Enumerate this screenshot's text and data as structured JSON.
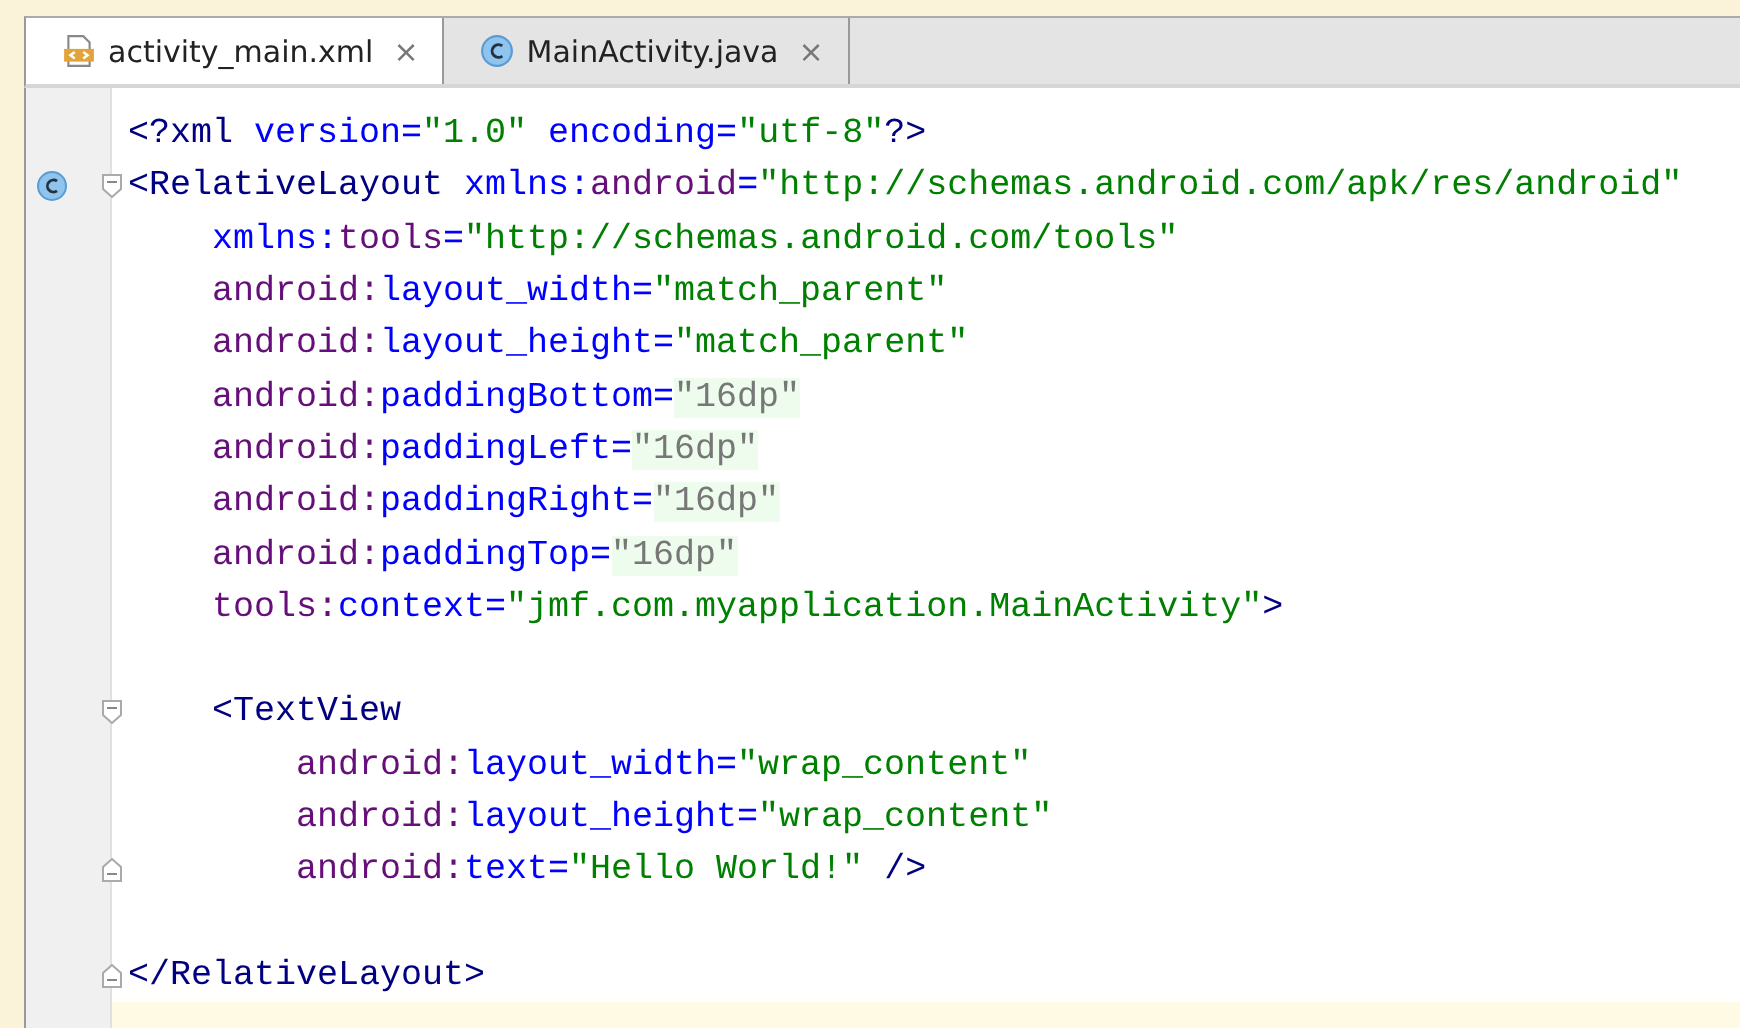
{
  "tabs": [
    {
      "label": "activity_main.xml",
      "kind": "xml",
      "selected": true,
      "close": "×"
    },
    {
      "label": "MainActivity.java",
      "kind": "class",
      "selected": false,
      "close": "×"
    }
  ],
  "lines": [
    {
      "kind": "plain",
      "tokens": [
        {
          "t": "<?xml",
          "kind": "tag"
        },
        {
          "t": " version=",
          "kind": "attr"
        },
        {
          "t": "\"1.0\"",
          "kind": "value"
        },
        {
          "t": " encoding=",
          "kind": "attr"
        },
        {
          "t": "\"utf-8\"",
          "kind": "value"
        },
        {
          "t": "?>",
          "kind": "tag"
        }
      ]
    },
    {
      "kind": "class-open",
      "tokens": [
        {
          "t": "<RelativeLayout",
          "kind": "tag"
        },
        {
          "t": " xmlns:",
          "kind": "attr"
        },
        {
          "t": "android",
          "kind": "ns"
        },
        {
          "t": "=",
          "kind": "attr"
        },
        {
          "t": "\"http://schemas.android.com/apk/res/android\"",
          "kind": "value"
        }
      ],
      "children": [
        {
          "kind": "plain",
          "tokens": [
            {
              "t": "xmlns:",
              "kind": "attr"
            },
            {
              "t": "tools",
              "kind": "ns"
            },
            {
              "t": "=",
              "kind": "attr"
            },
            {
              "t": "\"http://schemas.android.com/tools\"",
              "kind": "value"
            }
          ]
        },
        {
          "kind": "plain",
          "tokens": [
            {
              "t": "android:",
              "kind": "ns"
            },
            {
              "t": "layout_width=",
              "kind": "attr"
            },
            {
              "t": "\"match_parent\"",
              "kind": "value"
            }
          ]
        },
        {
          "kind": "plain",
          "tokens": [
            {
              "t": "android:",
              "kind": "ns"
            },
            {
              "t": "layout_height=",
              "kind": "attr"
            },
            {
              "t": "\"match_parent\"",
              "kind": "value"
            }
          ]
        },
        {
          "kind": "plain",
          "tokens": [
            {
              "t": "android:",
              "kind": "ns"
            },
            {
              "t": "paddingBottom=",
              "kind": "attr"
            },
            {
              "t": "\"16dp\"",
              "kind": "folded"
            }
          ]
        },
        {
          "kind": "plain",
          "tokens": [
            {
              "t": "android:",
              "kind": "ns"
            },
            {
              "t": "paddingLeft=",
              "kind": "attr"
            },
            {
              "t": "\"16dp\"",
              "kind": "folded"
            }
          ]
        },
        {
          "kind": "plain",
          "tokens": [
            {
              "t": "android:",
              "kind": "ns"
            },
            {
              "t": "paddingRight=",
              "kind": "attr"
            },
            {
              "t": "\"16dp\"",
              "kind": "folded"
            }
          ]
        },
        {
          "kind": "plain",
          "tokens": [
            {
              "t": "android:",
              "kind": "ns"
            },
            {
              "t": "paddingTop=",
              "kind": "attr"
            },
            {
              "t": "\"16dp\"",
              "kind": "folded"
            }
          ]
        },
        {
          "kind": "plain",
          "tokens": [
            {
              "t": "tools:",
              "kind": "ns"
            },
            {
              "t": "context=",
              "kind": "attr"
            },
            {
              "t": "\"jmf.com.myapplication.MainActivity\"",
              "kind": "value"
            },
            {
              "t": ">",
              "kind": "tag"
            }
          ]
        },
        {
          "kind": "open",
          "blank_before": true,
          "tokens": [
            {
              "t": "<TextView",
              "kind": "tag"
            }
          ],
          "children": [
            {
              "kind": "plain",
              "tokens": [
                {
                  "t": "android:",
                  "kind": "ns"
                },
                {
                  "t": "layout_width=",
                  "kind": "attr"
                },
                {
                  "t": "\"wrap_content\"",
                  "kind": "value"
                }
              ]
            },
            {
              "kind": "plain",
              "tokens": [
                {
                  "t": "android:",
                  "kind": "ns"
                },
                {
                  "t": "layout_height=",
                  "kind": "attr"
                },
                {
                  "t": "\"wrap_content\"",
                  "kind": "value"
                }
              ]
            },
            {
              "kind": "close",
              "tokens": [
                {
                  "t": "android:",
                  "kind": "ns"
                },
                {
                  "t": "text=",
                  "kind": "attr"
                },
                {
                  "t": "\"Hello World!\"",
                  "kind": "value"
                },
                {
                  "t": " />",
                  "kind": "tag"
                }
              ]
            }
          ]
        }
      ]
    },
    {
      "kind": "close",
      "blank_before": true,
      "tokens": [
        {
          "t": "</RelativeLayout>",
          "kind": "tag"
        }
      ]
    },
    {
      "kind": "plain",
      "current": true
    }
  ]
}
